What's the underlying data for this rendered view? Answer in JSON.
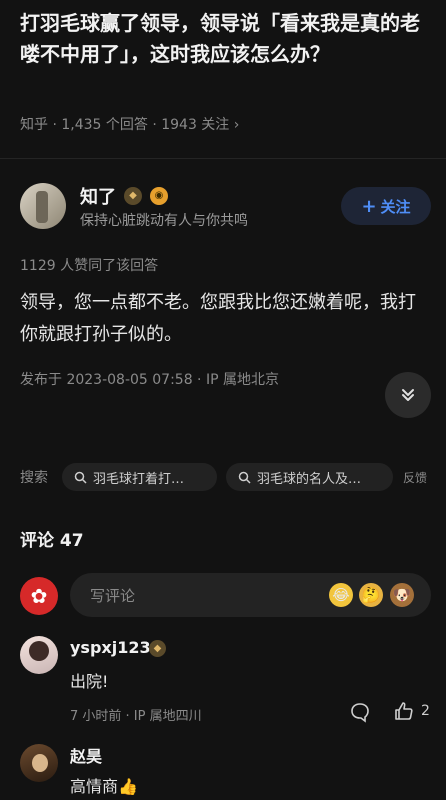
{
  "question": {
    "title": "打羽毛球赢了领导，领导说「看来我是真的老喽不中用了」，这时我应该怎么办？",
    "meta": "知乎 · 1,435 个回答 · 1943 关注 ›"
  },
  "author": {
    "name": "知了",
    "bio": "保持心脏跳动有人与你共鸣",
    "follow_label": "关注",
    "follow_plus": "+"
  },
  "answer": {
    "upvotes": "1129 人赞同了该回答",
    "content": "领导，您一点都不老。您跟我比您还嫩着呢，我打你就跟打孙子似的。",
    "meta": "发布于 2023-08-05 07:58 · IP 属地北京"
  },
  "search": {
    "label": "搜索",
    "chips": [
      "羽毛球打着打…",
      "羽毛球的名人及…"
    ],
    "feedback": "反馈"
  },
  "comments": {
    "header": "评论 47",
    "input_placeholder": "写评论",
    "items": [
      {
        "author": "yspxj123",
        "text": "出院!",
        "meta": "7 小时前 · IP 属地四川",
        "likes": "2"
      },
      {
        "author": "赵昊",
        "text": "高情商👍"
      }
    ]
  },
  "icons": {
    "collapse": "chevron-double-down-icon",
    "search_chip": "search-icon",
    "reply": "comment-icon",
    "like": "thumb-up-icon"
  },
  "colors": {
    "background": "#121212",
    "accent_blue": "#4f8ef7",
    "brand_red": "#d62929"
  }
}
